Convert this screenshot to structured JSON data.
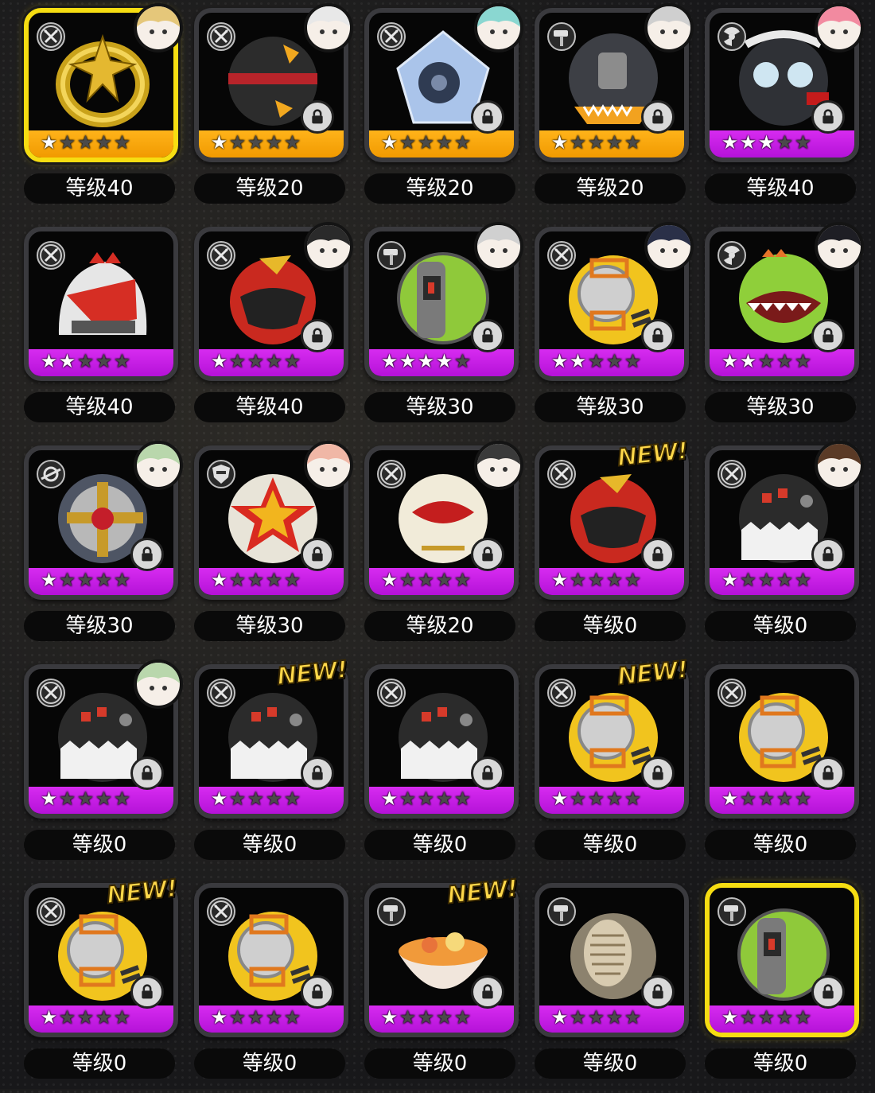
{
  "colors": {
    "gold_bar": "#f19a00",
    "purple_bar": "#b512d8",
    "selected_border": "#f6dd12",
    "new_badge": "#ffd84a"
  },
  "items": [
    {
      "level_label": "等级40",
      "rarity": "gold",
      "stars": 1,
      "selected": true,
      "type_icon": "crossed-swords-icon",
      "art": "golden-ring",
      "avatar": "blonde-character",
      "new": false
    },
    {
      "level_label": "等级20",
      "rarity": "gold",
      "stars": 1,
      "selected": false,
      "type_icon": "crossed-swords-icon",
      "art": "black-striped-ball",
      "avatar": "white-hair-character",
      "new": false
    },
    {
      "level_label": "等级20",
      "rarity": "gold",
      "stars": 1,
      "selected": false,
      "type_icon": "crossed-swords-icon",
      "art": "crystal-ball",
      "avatar": "teal-hair-character",
      "new": false
    },
    {
      "level_label": "等级20",
      "rarity": "gold",
      "stars": 1,
      "selected": false,
      "type_icon": "hammer-icon",
      "art": "shark-helmet-ball",
      "avatar": "masked-character",
      "new": false
    },
    {
      "level_label": "等级40",
      "rarity": "purple",
      "stars": 3,
      "selected": false,
      "type_icon": "radiation-icon",
      "art": "goggle-ball",
      "avatar": "pink-hair-character",
      "new": false
    },
    {
      "level_label": "等级40",
      "rarity": "purple",
      "stars": 2,
      "selected": false,
      "type_icon": "crossed-swords-icon",
      "art": "red-white-helmet",
      "avatar": "",
      "new": false
    },
    {
      "level_label": "等级40",
      "rarity": "purple",
      "stars": 1,
      "selected": false,
      "type_icon": "crossed-swords-icon",
      "art": "red-visor-ball",
      "avatar": "dark-hair-character",
      "new": false
    },
    {
      "level_label": "等级30",
      "rarity": "purple",
      "stars": 4,
      "selected": false,
      "type_icon": "hammer-icon",
      "art": "green-machine-ball",
      "avatar": "silver-hair-character",
      "new": false
    },
    {
      "level_label": "等级30",
      "rarity": "purple",
      "stars": 2,
      "selected": false,
      "type_icon": "crossed-swords-icon",
      "art": "yellow-hatch-ball",
      "avatar": "navy-hair-character",
      "new": false
    },
    {
      "level_label": "等级30",
      "rarity": "purple",
      "stars": 2,
      "selected": false,
      "type_icon": "radiation-icon",
      "art": "green-monster-ball",
      "avatar": "black-hair-character",
      "new": false
    },
    {
      "level_label": "等级30",
      "rarity": "purple",
      "stars": 1,
      "selected": false,
      "type_icon": "orbit-icon",
      "art": "gear-vault-ball",
      "avatar": "green-hair-character",
      "new": false
    },
    {
      "level_label": "等级30",
      "rarity": "purple",
      "stars": 1,
      "selected": false,
      "type_icon": "shield-icon",
      "art": "star-emblem-ball",
      "avatar": "peach-hair-character",
      "new": false
    },
    {
      "level_label": "等级20",
      "rarity": "purple",
      "stars": 1,
      "selected": false,
      "type_icon": "crossed-swords-icon",
      "art": "cat-face-ball",
      "avatar": "armored-character",
      "new": false
    },
    {
      "level_label": "等级0",
      "rarity": "purple",
      "stars": 1,
      "selected": false,
      "type_icon": "crossed-swords-icon",
      "art": "red-visor-ball",
      "avatar": "",
      "new": true
    },
    {
      "level_label": "等级0",
      "rarity": "purple",
      "stars": 1,
      "selected": false,
      "type_icon": "crossed-swords-icon",
      "art": "penguin-mech-ball",
      "avatar": "brown-hair-character",
      "new": false
    },
    {
      "level_label": "等级0",
      "rarity": "purple",
      "stars": 1,
      "selected": false,
      "type_icon": "crossed-swords-icon",
      "art": "penguin-mech-ball",
      "avatar": "green-hair-character",
      "new": false
    },
    {
      "level_label": "等级0",
      "rarity": "purple",
      "stars": 1,
      "selected": false,
      "type_icon": "crossed-swords-icon",
      "art": "penguin-mech-ball",
      "avatar": "",
      "new": true
    },
    {
      "level_label": "等级0",
      "rarity": "purple",
      "stars": 1,
      "selected": false,
      "type_icon": "crossed-swords-icon",
      "art": "penguin-mech-ball",
      "avatar": "",
      "new": false
    },
    {
      "level_label": "等级0",
      "rarity": "purple",
      "stars": 1,
      "selected": false,
      "type_icon": "crossed-swords-icon",
      "art": "yellow-hatch-ball",
      "avatar": "",
      "new": true
    },
    {
      "level_label": "等级0",
      "rarity": "purple",
      "stars": 1,
      "selected": false,
      "type_icon": "crossed-swords-icon",
      "art": "yellow-hatch-ball",
      "avatar": "",
      "new": false
    },
    {
      "level_label": "等级0",
      "rarity": "purple",
      "stars": 1,
      "selected": false,
      "type_icon": "crossed-swords-icon",
      "art": "yellow-hatch-ball",
      "avatar": "",
      "new": true
    },
    {
      "level_label": "等级0",
      "rarity": "purple",
      "stars": 1,
      "selected": false,
      "type_icon": "crossed-swords-icon",
      "art": "yellow-hatch-ball",
      "avatar": "",
      "new": false
    },
    {
      "level_label": "等级0",
      "rarity": "purple",
      "stars": 1,
      "selected": false,
      "type_icon": "hammer-icon",
      "art": "food-bowl-ball",
      "avatar": "",
      "new": true
    },
    {
      "level_label": "等级0",
      "rarity": "purple",
      "stars": 1,
      "selected": false,
      "type_icon": "hammer-icon",
      "art": "fossil-rock-ball",
      "avatar": "",
      "new": false
    },
    {
      "level_label": "等级0",
      "rarity": "purple",
      "stars": 1,
      "selected": true,
      "type_icon": "hammer-icon",
      "art": "green-machine-ball",
      "avatar": "",
      "new": false
    }
  ],
  "new_badge_text": "NEW!"
}
